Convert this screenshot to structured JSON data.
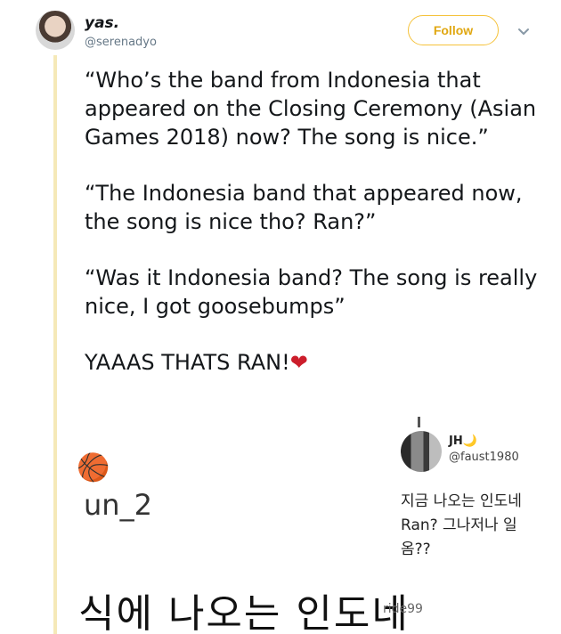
{
  "tweet": {
    "display_name": "yas.",
    "handle": "@serenadyo",
    "follow_label": "Follow",
    "paragraphs": [
      "“Who’s the band from Indonesia that appeared on the Closing Ceremony (Asian Games 2018) now? The song is nice.”",
      "“The Indonesia band that appeared now, the song is nice tho? Ran?”",
      "“Was it Indonesia band? The song is really nice, I got goosebumps”",
      "YAAAS THATS RAN!"
    ],
    "heart_glyph": "❤"
  },
  "media": {
    "basketball_glyph": "🏀",
    "mention_user": "un_2",
    "korean_big": "식에 나오는 인도네",
    "embedded": {
      "name": "JH",
      "moon_glyph": "🌙",
      "handle": "@faust1980",
      "lines": [
        "지금 나오는 인도네",
        "Ran? 그나저나 일",
        "옴??"
      ],
      "footer_handle": "ride99"
    }
  },
  "colors": {
    "accent": "#f5c23a",
    "follow_text": "#e0a711",
    "thread_line": "#f5e9b8",
    "heart": "#cc1d2b"
  }
}
